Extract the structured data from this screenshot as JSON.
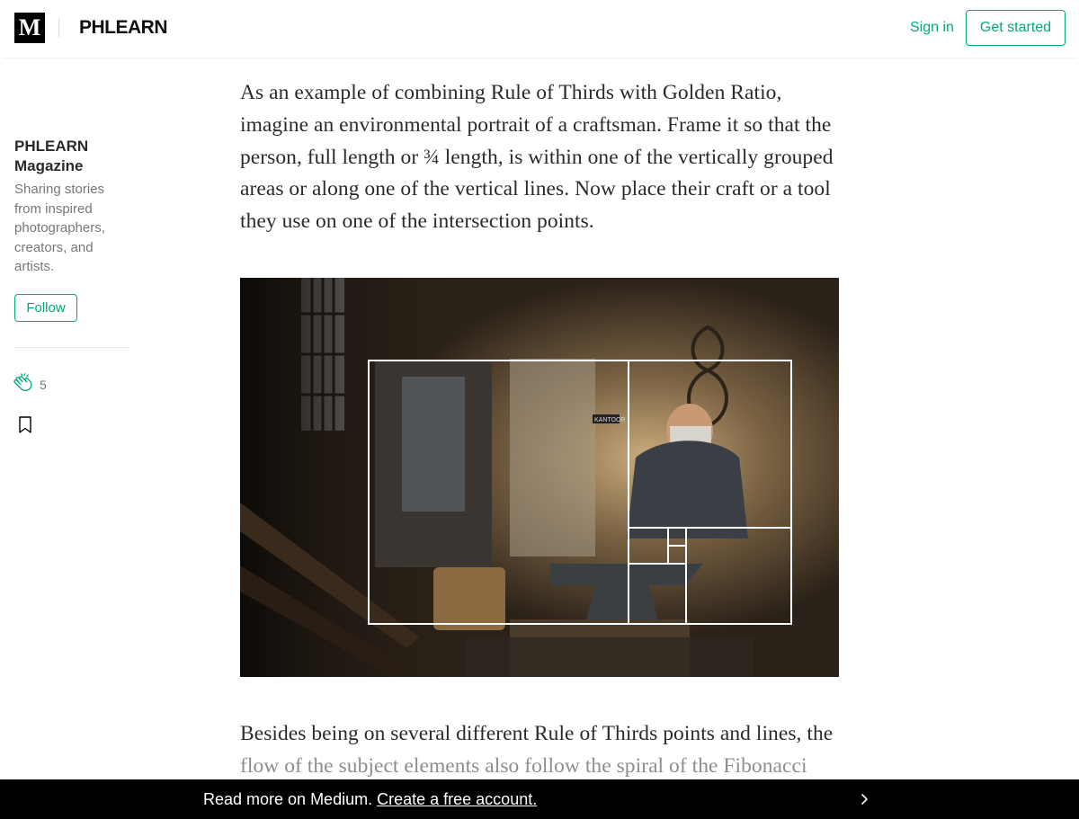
{
  "header": {
    "site_logo": "M",
    "publication_logo": "PHLEARN",
    "sign_in": "Sign in",
    "get_started": "Get started"
  },
  "sidebar": {
    "pub_name": "PHLEARN Magazine",
    "pub_description": "Sharing stories from inspired photographers, creators, and artists.",
    "follow": "Follow",
    "clap_count": "5",
    "icons": [
      "clap-icon",
      "bookmark-icon"
    ]
  },
  "article": {
    "paragraph1": "As an example of combining Rule of Thirds with Golden Ratio, imagine an environmental portrait of a craftsman. Frame it so that the person, full length or ¾ length, is within one of the vertically grouped areas or along one of the vertical lines. Now place their craft or a tool they use on one of the intersection points.",
    "paragraph2_visible": "Besides being on several different Rule of Thirds points and lines, the",
    "paragraph2_faded": "flow of the subject elements also follow the spiral of the Fibonacci",
    "image_label": "KANTOOR"
  },
  "bottom_banner": {
    "text": "Read more on Medium.",
    "link": "Create a free account.",
    "icon": "chevron-right-icon"
  },
  "colors": {
    "accent": "#03a87c",
    "banner": "#000000",
    "text": "rgba(0,0,0,0.84)"
  }
}
